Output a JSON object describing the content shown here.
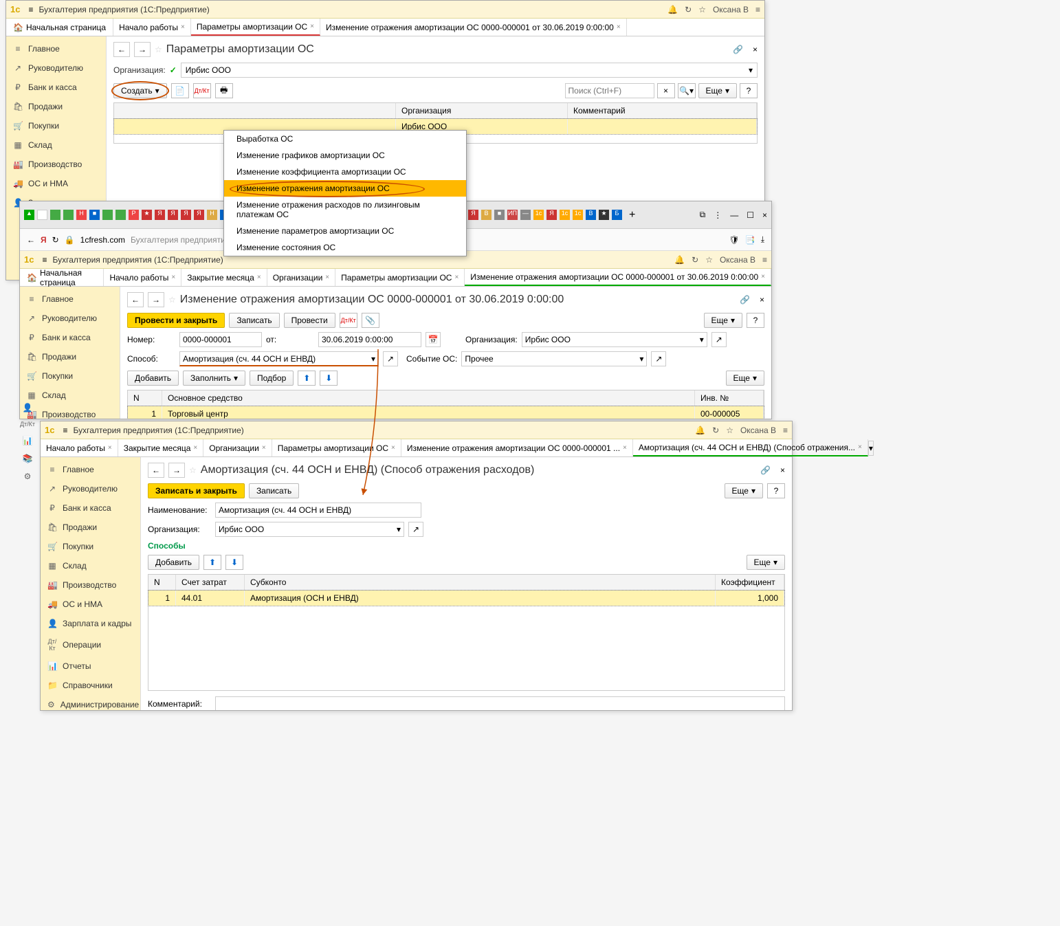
{
  "app": {
    "title": "Бухгалтерия предприятия  (1С:Предприятие)",
    "user": "Оксана В"
  },
  "sidebar": {
    "items": [
      {
        "icon": "≡",
        "label": "Главное"
      },
      {
        "icon": "↗",
        "label": "Руководителю"
      },
      {
        "icon": "₽",
        "label": "Банк и касса"
      },
      {
        "icon": "🛍",
        "label": "Продажи"
      },
      {
        "icon": "🛒",
        "label": "Покупки"
      },
      {
        "icon": "▦",
        "label": "Склад"
      },
      {
        "icon": "🏭",
        "label": "Производство"
      },
      {
        "icon": "🚚",
        "label": "ОС и НМА"
      },
      {
        "icon": "👤",
        "label": "Зарплата и кадры"
      },
      {
        "icon": "Дт/Кт",
        "label": "Операции"
      },
      {
        "icon": "📊",
        "label": "Отчеты"
      },
      {
        "icon": "📁",
        "label": "Справочники"
      },
      {
        "icon": "⚙",
        "label": "Администрирование"
      }
    ]
  },
  "win1": {
    "tabs": {
      "home": "Начальная страница",
      "t1": "Начало работы",
      "t2": "Параметры амортизации ОС",
      "t3": "Изменение отражения амортизации ОС 0000-000001 от 30.06.2019 0:00:00"
    },
    "page_title": "Параметры амортизации ОС",
    "org_label": "Организация:",
    "org_value": "Ирбис ООО",
    "create_btn": "Создать",
    "search_placeholder": "Поиск (Ctrl+F)",
    "more_btn": "Еще",
    "grid": {
      "col_org": "Организация",
      "col_comment": "Комментарий",
      "row_org": "Ирбис ООО"
    },
    "dropdown": [
      "Выработка ОС",
      "Изменение графиков амортизации ОС",
      "Изменение коэффициента амортизации ОС",
      "Изменение отражения амортизации ОС",
      "Изменение отражения расходов по лизинговым платежам ОС",
      "Изменение параметров амортизации ОС",
      "Изменение состояния ОС"
    ]
  },
  "win2": {
    "browser_url": "1cfresh.com",
    "browser_title": "Бухгалтерия предприятия (1С:Предприятие)",
    "tabs": {
      "home": "Начальная страница",
      "t1": "Начало работы",
      "t2": "Закрытие месяца",
      "t3": "Организации",
      "t4": "Параметры амортизации ОС",
      "t5": "Изменение отражения амортизации ОС 0000-000001 от 30.06.2019 0:00:00"
    },
    "page_title": "Изменение отражения амортизации ОС 0000-000001 от 30.06.2019 0:00:00",
    "btn_post_close": "Провести и закрыть",
    "btn_write": "Записать",
    "btn_post": "Провести",
    "more_btn": "Еще",
    "lbl_number": "Номер:",
    "val_number": "0000-000001",
    "lbl_from": "от:",
    "val_date": "30.06.2019  0:00:00",
    "lbl_org": "Организация:",
    "val_org": "Ирбис ООО",
    "lbl_method": "Способ:",
    "val_method": "Амортизация (сч. 44 ОСН и ЕНВД)",
    "lbl_event": "Событие ОС:",
    "val_event": "Прочее",
    "btn_add": "Добавить",
    "btn_fill": "Заполнить",
    "btn_pick": "Подбор",
    "grid": {
      "col_n": "N",
      "col_os": "Основное средство",
      "col_inv": "Инв. №",
      "row_n": "1",
      "row_os": "Торговый центр",
      "row_inv": "00-000005"
    }
  },
  "win3": {
    "tabs": {
      "t1": "Начало работы",
      "t2": "Закрытие месяца",
      "t3": "Организации",
      "t4": "Параметры амортизации ОС",
      "t5": "Изменение отражения амортизации ОС 0000-000001 ...",
      "t6": "Амортизация (сч. 44 ОСН и ЕНВД) (Способ отражения..."
    },
    "page_title": "Амортизация (сч. 44 ОСН и ЕНВД) (Способ отражения расходов)",
    "btn_write_close": "Записать и закрыть",
    "btn_write": "Записать",
    "more_btn": "Еще",
    "lbl_name": "Наименование:",
    "val_name": "Амортизация (сч. 44 ОСН и ЕНВД)",
    "lbl_org": "Организация:",
    "val_org": "Ирбис ООО",
    "section": "Способы",
    "btn_add": "Добавить",
    "grid": {
      "col_n": "N",
      "col_acc": "Счет затрат",
      "col_sub": "Субконто",
      "col_coef": "Коэффициент",
      "row_n": "1",
      "row_acc": "44.01",
      "row_sub": "Амортизация (ОСН и ЕНВД)",
      "row_coef": "1,000"
    },
    "lbl_comment": "Комментарий:"
  }
}
